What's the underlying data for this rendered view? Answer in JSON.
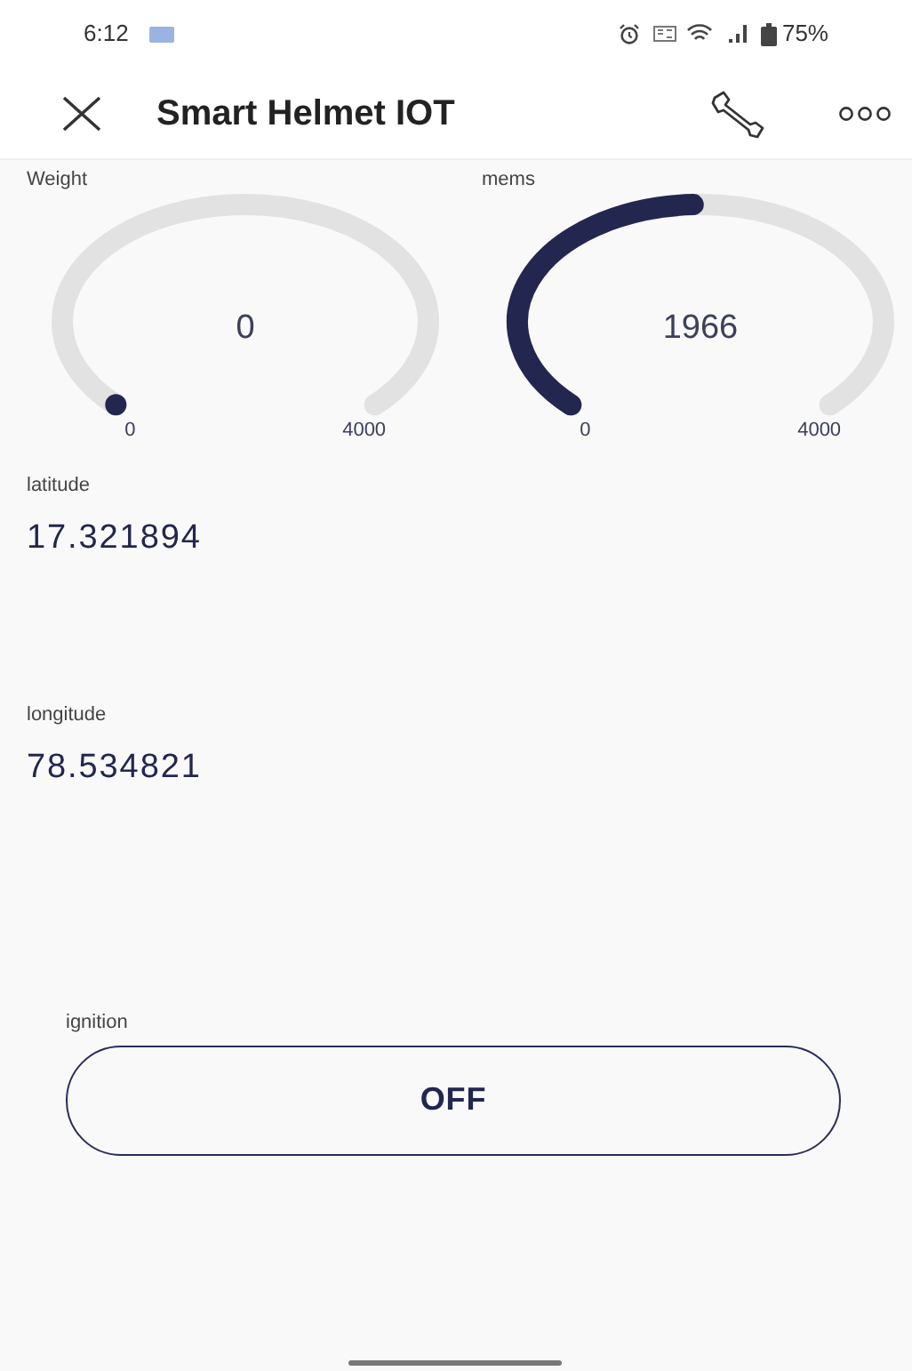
{
  "status_bar": {
    "time": "6:12",
    "battery": "75%"
  },
  "header": {
    "title": "Smart Helmet IOT"
  },
  "gauges": [
    {
      "label": "Weight",
      "value": "0",
      "min": "0",
      "max": "4000"
    },
    {
      "label": "mems",
      "value": "1966",
      "min": "0",
      "max": "4000"
    }
  ],
  "displays": [
    {
      "label": "latitude",
      "value": "17.321894"
    },
    {
      "label": "longitude",
      "value": "78.534821"
    }
  ],
  "button": {
    "label": "ignition",
    "text": "OFF"
  }
}
